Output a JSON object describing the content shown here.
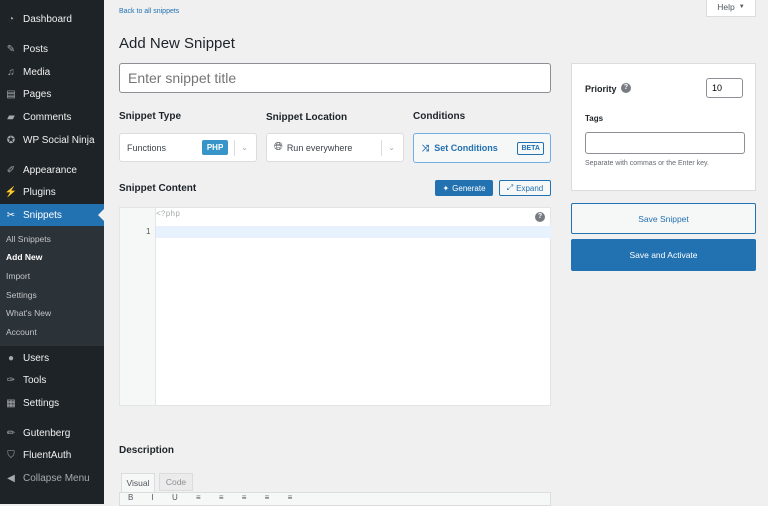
{
  "sidebar": {
    "items": [
      {
        "label": "Dashboard",
        "icon": "dashboard-icon",
        "glyph": "◔"
      },
      {
        "label": "Posts",
        "icon": "pin-icon",
        "glyph": "✎"
      },
      {
        "label": "Media",
        "icon": "media-icon",
        "glyph": "♫"
      },
      {
        "label": "Pages",
        "icon": "pages-icon",
        "glyph": "▤"
      },
      {
        "label": "Comments",
        "icon": "comment-icon",
        "glyph": "▰"
      },
      {
        "label": "WP Social Ninja",
        "icon": "social-ninja-icon",
        "glyph": "✪"
      },
      {
        "label": "Appearance",
        "icon": "brush-icon",
        "glyph": "✐"
      },
      {
        "label": "Plugins",
        "icon": "plug-icon",
        "glyph": "⚡"
      },
      {
        "label": "Snippets",
        "icon": "scissors-icon",
        "glyph": "✂"
      },
      {
        "label": "Users",
        "icon": "user-icon",
        "glyph": "●"
      },
      {
        "label": "Tools",
        "icon": "wrench-icon",
        "glyph": "✑"
      },
      {
        "label": "Settings",
        "icon": "settings-icon",
        "glyph": "▦"
      },
      {
        "label": "Gutenberg",
        "icon": "pencil-icon",
        "glyph": "✏"
      },
      {
        "label": "FluentAuth",
        "icon": "shield-icon",
        "glyph": "⛉"
      },
      {
        "label": "Collapse Menu",
        "icon": "collapse-icon",
        "glyph": "◀"
      }
    ],
    "submenu": [
      "All Snippets",
      "Add New",
      "Import",
      "Settings",
      "What's New",
      "Account"
    ]
  },
  "help": "Help",
  "back_link": "Back to all snippets",
  "page_title": "Add New Snippet",
  "title_placeholder": "Enter snippet title",
  "type": {
    "label": "Snippet Type",
    "value": "Functions",
    "badge": "PHP"
  },
  "location": {
    "label": "Snippet Location",
    "value": "Run everywhere"
  },
  "conditions": {
    "label": "Conditions",
    "button": "Set Conditions",
    "badge": "BETA"
  },
  "content": {
    "label": "Snippet Content",
    "generate": "Generate",
    "expand": "Expand",
    "code_header": "<?php",
    "line": "1"
  },
  "description": {
    "label": "Description",
    "tabs": [
      "Visual",
      "Code"
    ]
  },
  "priority": {
    "label": "Priority",
    "value": "10"
  },
  "tags": {
    "label": "Tags",
    "hint": "Separate with commas or the Enter key."
  },
  "save": "Save Snippet",
  "save_activate": "Save and Activate",
  "colors": {
    "accent": "#2271b1",
    "sidebar": "#1d2327"
  }
}
